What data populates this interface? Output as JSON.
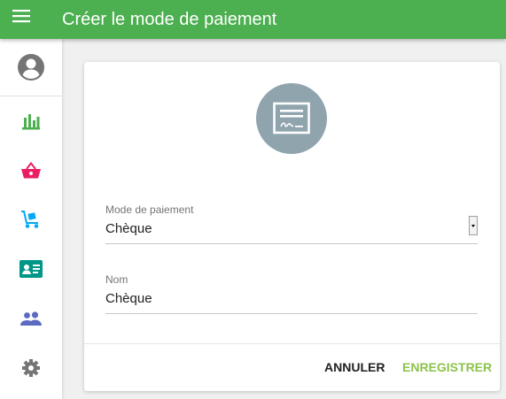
{
  "appbar": {
    "title": "Créer le mode de paiement",
    "background_color": "#4caf50",
    "menu_icon": "menu-icon"
  },
  "sidebar": {
    "account_icon": "account-circle-icon",
    "items": [
      {
        "name": "stats",
        "icon": "bar-chart-icon",
        "color": "#4caf50"
      },
      {
        "name": "basket",
        "icon": "basket-icon",
        "color": "#e91e63"
      },
      {
        "name": "delivery",
        "icon": "hand-truck-icon",
        "color": "#03a9f4"
      },
      {
        "name": "contact-card",
        "icon": "contact-card-icon",
        "color": "#009688"
      },
      {
        "name": "people",
        "icon": "people-icon",
        "color": "#5c6bc0"
      },
      {
        "name": "settings",
        "icon": "gear-icon",
        "color": "#757575"
      }
    ]
  },
  "form": {
    "header_icon": "cheque-icon",
    "header_icon_bg": "#90a4ae",
    "payment_mode": {
      "label": "Mode de paiement",
      "value": "Chèque"
    },
    "name": {
      "label": "Nom",
      "value": "Chèque"
    },
    "cancel_label": "ANNULER",
    "save_label": "ENREGISTRER",
    "save_color": "#8bc34a"
  }
}
